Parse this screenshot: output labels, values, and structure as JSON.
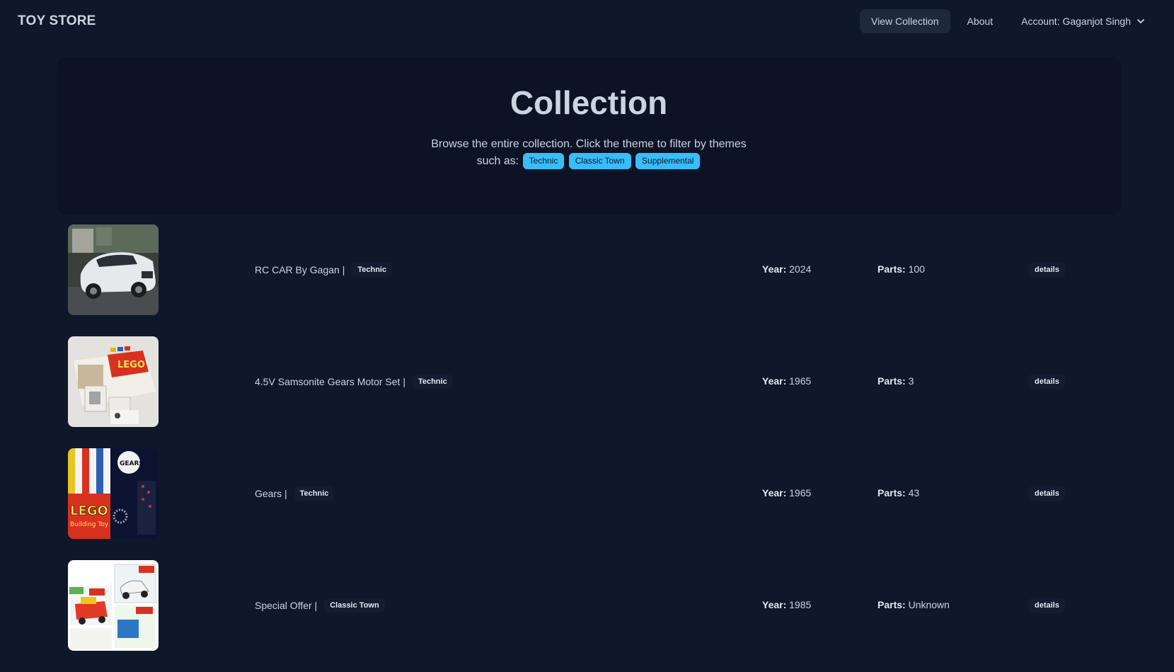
{
  "brand": "TOY STORE",
  "nav": {
    "view_collection": "View Collection",
    "about": "About",
    "account": "Account: Gaganjot Singh"
  },
  "hero": {
    "title": "Collection",
    "description": "Browse the entire collection. Click the theme to filter by themes such as:",
    "themes": [
      "Technic",
      "Classic Town",
      "Supplemental"
    ]
  },
  "labels": {
    "year": "Year:",
    "parts": "Parts:",
    "details": "details"
  },
  "sets": [
    {
      "name": "RC CAR By Gagan |",
      "theme": "Technic",
      "year": "2024",
      "parts": "100",
      "image": "white-car-photo"
    },
    {
      "name": "4.5V Samsonite Gears Motor Set |",
      "theme": "Technic",
      "year": "1965",
      "parts": "3",
      "image": "lego-gears-motor-box-photo"
    },
    {
      "name": "Gears |",
      "theme": "Technic",
      "year": "1965",
      "parts": "43",
      "image": "lego-gears-box-photo"
    },
    {
      "name": "Special Offer |",
      "theme": "Classic Town",
      "year": "1985",
      "parts": "Unknown",
      "image": "lego-town-boxes-photo"
    }
  ]
}
